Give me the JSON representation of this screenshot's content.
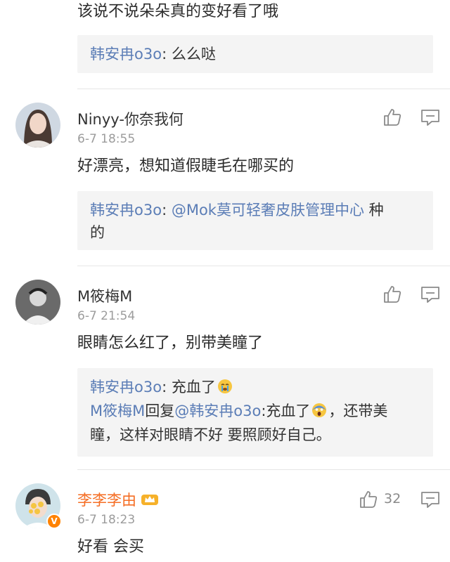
{
  "top_comment": {
    "content": "该说不说朵朵真的变好看了哦",
    "reply": {
      "author": "韩安冉o3o",
      "text": ": 么么哒"
    }
  },
  "comments": [
    {
      "username": "Ninyy-你奈我何",
      "time": "6-7 18:55",
      "content": "好漂亮，想知道假睫毛在哪买的",
      "reply": {
        "author": "韩安冉o3o",
        "colon": ": ",
        "mention": "@Mok莫可轻奢皮肤管理中心",
        "text_after": " 种",
        "text_line2": "的"
      }
    },
    {
      "username": "M筱梅M",
      "time": "6-7 21:54",
      "content": "眼睛怎么红了，别带美瞳了",
      "replies": [
        {
          "author": "韩安冉o3o",
          "text": ": 充血了"
        },
        {
          "author": "M筱梅M",
          "reply_word": "回复",
          "mention": "@韩安冉o3o",
          "text": ":充血了",
          "text_after": "，还带美",
          "text_line2": "瞳，这样对眼睛不好 要照顾好自己。"
        }
      ]
    },
    {
      "username": "李李李由",
      "time": "6-7 18:23",
      "content": "好看 会买",
      "likes": "32",
      "verified_badge": "V"
    }
  ],
  "icons": [
    "like-icon",
    "comment-icon",
    "crown-icon",
    "crying-emoji-icon",
    "screaming-emoji-icon"
  ],
  "colors": {
    "link": "#5b7db6",
    "vip_name": "#f56d23",
    "timestamp": "#9c9c9c",
    "reply_bg": "#f4f4f4",
    "verified": "#ff8200"
  }
}
